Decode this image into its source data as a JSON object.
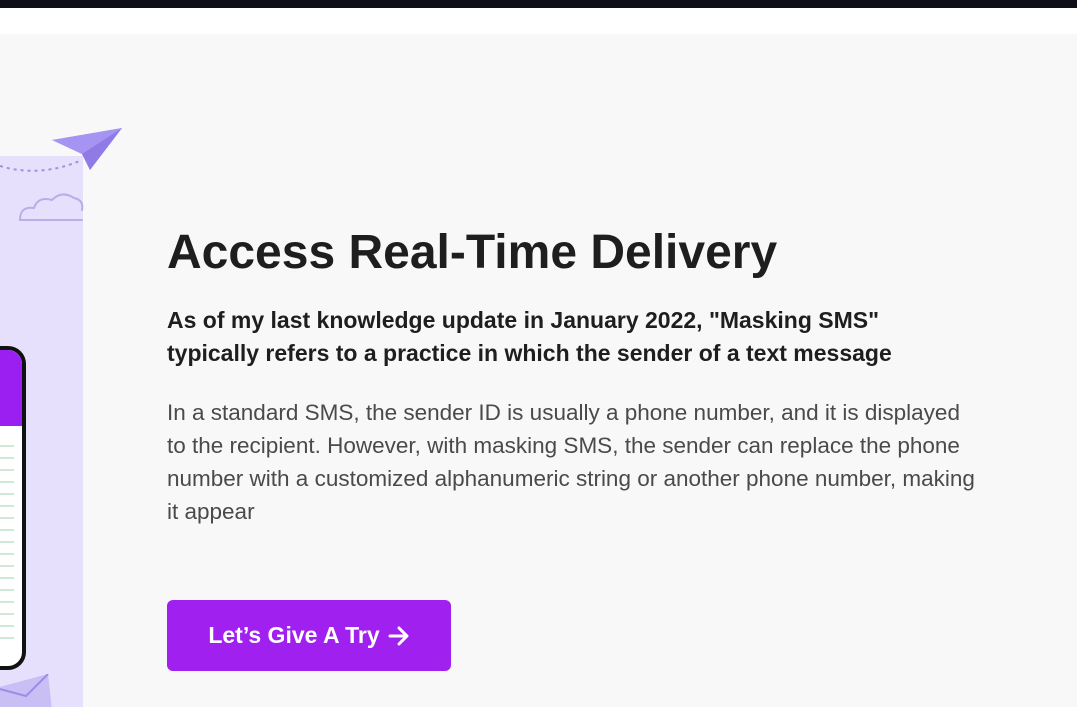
{
  "hero": {
    "title": "Access Real-Time Delivery",
    "lead": "As of my last knowledge update in January 2022, \"Masking SMS\" typically refers to a practice in which the sender of a text message",
    "body": "In a standard SMS, the sender ID is usually a phone number, and it is displayed to the recipient. However, with masking SMS, the sender can replace the phone number with a customized alphanumeric string or another phone number, making it appear",
    "cta_label": "Let’s Give A Try",
    "cta_icon": "arrow-right-icon"
  },
  "illustration": {
    "icons": [
      "paper-plane-icon",
      "cloud-icon",
      "phone-mockup",
      "envelope-icon"
    ]
  },
  "colors": {
    "accent": "#a020f0",
    "section_bg": "#f8f8f8",
    "panel_bg": "#e6e0fc",
    "title": "#1e1e1e",
    "body": "#4a4a4a",
    "top_bar": "#0f0f1a"
  }
}
